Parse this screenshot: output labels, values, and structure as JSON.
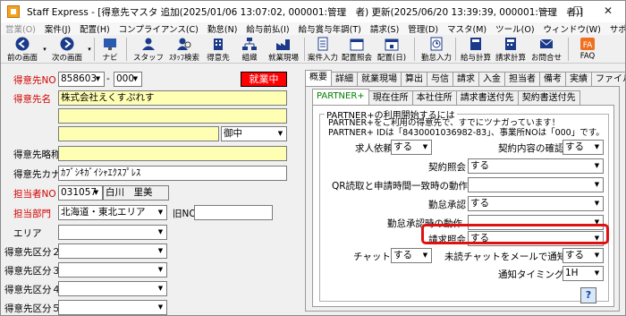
{
  "window": {
    "title": "Staff Express - [得意先マスタ 追加(2025/01/06 13:07:02, 000001:管理　者) 更新(2025/06/20 13:39:39, 000001:管理　者)]",
    "minimize": "—",
    "maximize": "☐",
    "close": "✕"
  },
  "menu": [
    {
      "label": "営業(O)",
      "dim": true
    },
    {
      "label": "案件(J)",
      "dim": false
    },
    {
      "label": "配置(H)",
      "dim": false
    },
    {
      "label": "コンプライアンス(C)",
      "dim": false
    },
    {
      "label": "勤怠(N)",
      "dim": false
    },
    {
      "label": "給与前払(I)",
      "dim": false
    },
    {
      "label": "給与賞与年調(T)",
      "dim": false
    },
    {
      "label": "請求(S)",
      "dim": false
    },
    {
      "label": "管理(D)",
      "dim": false
    },
    {
      "label": "マスタ(M)",
      "dim": false
    },
    {
      "label": "ツール(O)",
      "dim": false
    },
    {
      "label": "ウィンドウ(W)",
      "dim": false
    },
    {
      "label": "サポート(H)",
      "dim": false
    }
  ],
  "toolbar": {
    "prev": "前の画面",
    "next": "次の画面",
    "navi": "ナビ",
    "staff": "スタッフ",
    "staff_search": "ｽﾀｯﾌ検索",
    "client": "得意先",
    "org": "組織",
    "site": "就業現場",
    "job_input": "案件入力",
    "assign_confirm": "配置照会",
    "assign_d": "配置(日)",
    "attendance_input": "勤怠入力",
    "payroll_calc": "給与計算",
    "billing_calc": "請求計算",
    "notice": "お問合せ",
    "faq": "FAQ"
  },
  "form": {
    "client_no_label": "得意先NO",
    "client_no": "858603",
    "client_no_sub": "000",
    "status_badge": "就業中",
    "client_name_label": "得意先名",
    "client_name_1": "株式会社えくすぷれす",
    "client_name_2": "",
    "client_name_3": "",
    "honorific": "御中",
    "short_name_label": "得意先略称",
    "short_name": "",
    "kana_label": "得意先カナ",
    "kana": "ｶﾌﾞｼｷｶﾞｲｼｬｴｸｽﾌﾟﾚｽ",
    "rep_no_label": "担当者NO",
    "rep_no": "031057",
    "rep_name": "白川　里美",
    "dept_label": "担当部門",
    "dept": "北海道・東北エリア",
    "old_no_label": "旧NO",
    "old_no": "",
    "area_label": "エリア",
    "cat2_label": "得意先区分２",
    "cat3_label": "得意先区分３",
    "cat4_label": "得意先区分４",
    "cat5_label": "得意先区分５"
  },
  "tabs_top": [
    "概要",
    "詳細",
    "就業現場",
    "算出",
    "与信",
    "請求",
    "入金",
    "担当者",
    "備考",
    "実績",
    "ファイル"
  ],
  "tabs_sub": [
    "PARTNER+",
    "現在住所",
    "本社住所",
    "請求書送付先",
    "契約書送付先"
  ],
  "partner": {
    "group_title": "PARTNER+の利用開始するには",
    "note_line1": "PARTNER+をご利用の得意先で、すでにツナガっています！",
    "note_line2": "PARTNER+ IDは「8430001036982-83」、事業所NOは「000」です。",
    "ask_label": "求人依頼",
    "ask_value": "する",
    "contract_confirm_label": "契約内容の確認",
    "contract_confirm_value": "する",
    "contract_inquiry_label": "契約照会",
    "contract_inquiry_value": "する",
    "qr_label": "QR読取と申請時間一致時の動作",
    "qr_value": "",
    "attendance_approval_label": "勤怠承認",
    "attendance_approval_value": "する",
    "attendance_approval_action_label": "勤怠承認時の動作",
    "attendance_approval_action_value": "",
    "billing_inquiry_label": "請求照会",
    "billing_inquiry_value": "する",
    "chat_label": "チャット",
    "chat_value": "する",
    "unread_chat_label": "未読チャットをメールで通知",
    "unread_chat_value": "する",
    "notify_timing_label": "通知タイミング",
    "notify_timing_value": "1H",
    "help": "?"
  },
  "colors": {
    "highlight": "#e01010",
    "required_label": "#d40000",
    "yellow_field": "#ffffb4",
    "status_badge": "#ff0000"
  }
}
